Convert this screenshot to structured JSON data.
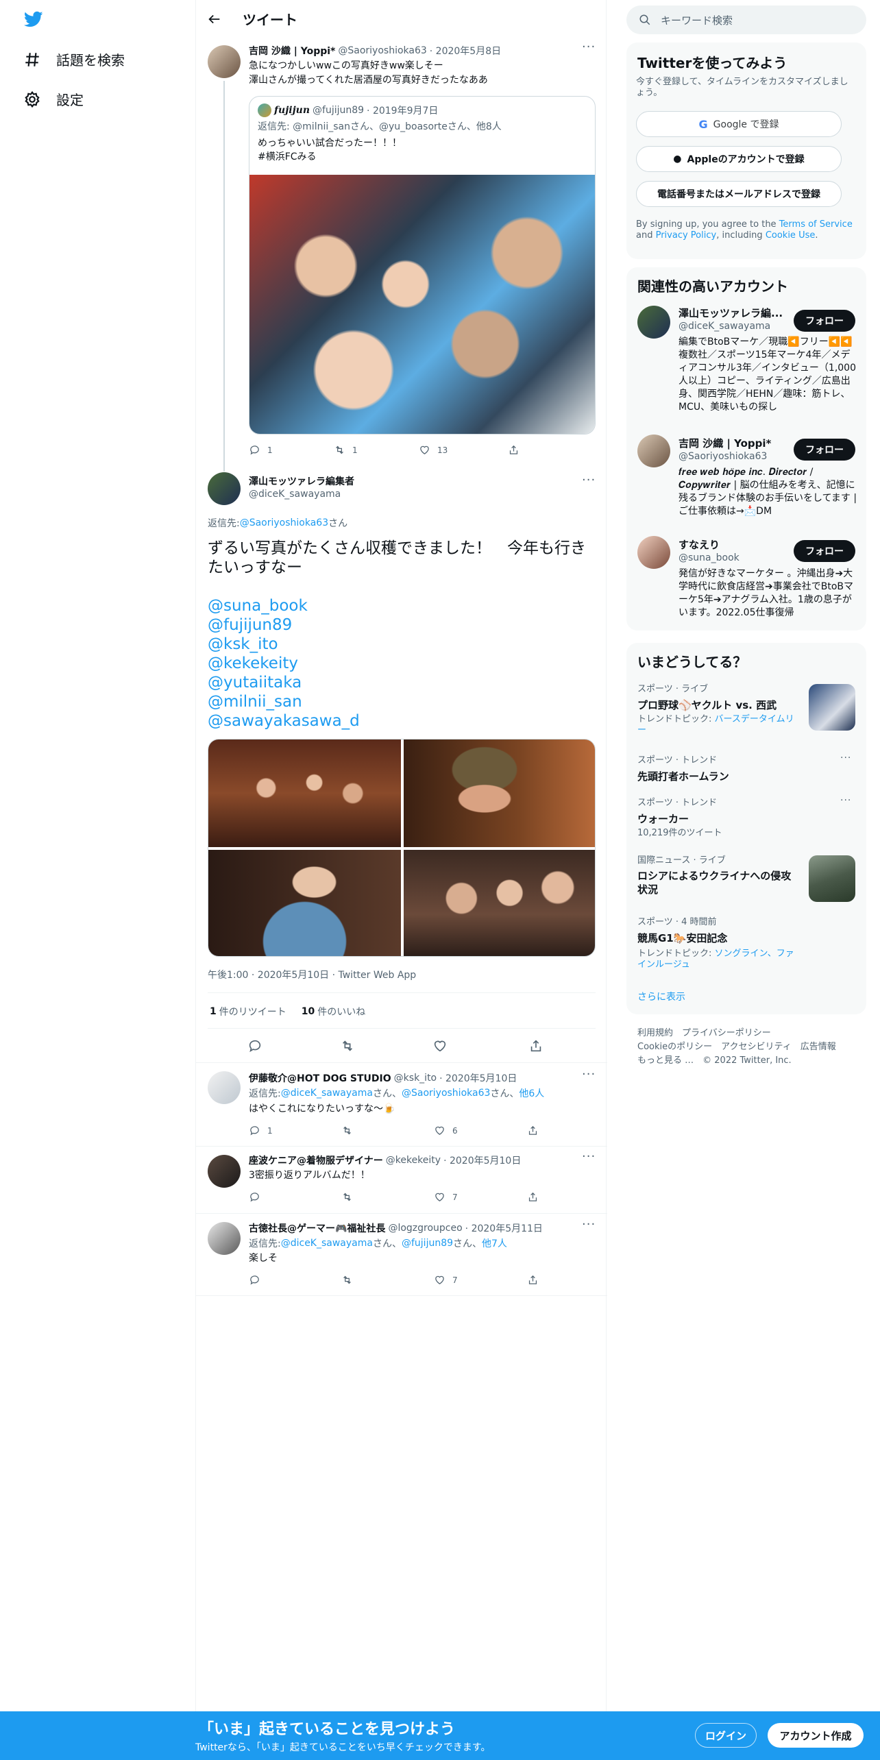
{
  "nav": {
    "explore": "話題を検索",
    "settings": "設定"
  },
  "header": {
    "title": "ツイート"
  },
  "tweet1": {
    "name": "吉岡 沙織 | Yoppi*",
    "handle": "@Saoriyoshioka63",
    "date": "· 2020年5月8日",
    "line1": "急になつかしいwwこの写真好きww楽しそー",
    "line2": "澤山さんが撮ってくれた居酒屋の写真好きだったなああ",
    "quote": {
      "name": "fujijun",
      "handle": "@fujijun89",
      "date": "· 2019年9月7日",
      "reply": "返信先: @milnii_sanさん、@yu_boasorteさん、他8人",
      "line1": "めっちゃいい試合だったー！！！",
      "line2": "#横浜FCみる"
    },
    "replies": "1",
    "retweets": "1",
    "likes": "13"
  },
  "main": {
    "name": "澤山モッツァレラ編集者",
    "handle": "@diceK_sawayama",
    "reply_prefix": "返信先: ",
    "reply_to": "@Saoriyoshioka63",
    "reply_suffix": "さん",
    "text": "ずるい写真がたくさん収穫できました！　今年も行きたいっすなー",
    "mentions": [
      "@suna_book",
      "@fujijun89",
      "@ksk_ito",
      "@kekekeity",
      "@yutaiitaka",
      "@milnii_san",
      "@sawayakasawa_d"
    ],
    "meta": "午後1:00 · 2020年5月10日 · Twitter Web App",
    "retweets_count": "1",
    "retweets_label": "件のリツイート",
    "likes_count": "10",
    "likes_label": "件のいいね"
  },
  "reply1": {
    "name": "伊藤敬介@HOT DOG STUDIO",
    "handle": "@ksk_ito",
    "date": "· 2020年5月10日",
    "reply_prefix": "返信先: ",
    "to1": "@diceK_sawayama",
    "sep1": "さん、",
    "to2": "@Saoriyoshioka63",
    "sep2": "さん、",
    "more": "他6人",
    "text": "はやくこれになりたいっすな〜🍺",
    "replies": "1",
    "likes": "6"
  },
  "reply2": {
    "name": "座波ケニア@着物服デザイナー",
    "handle": "@kekekeity",
    "date": "· 2020年5月10日",
    "text": "3密振り返りアルバムだ！！",
    "likes": "7"
  },
  "reply3": {
    "name": "古徳社長@ゲーマー🎮福祉社長",
    "handle": "@logzgroupceo",
    "date": "· 2020年5月11日",
    "reply_prefix": "返信先: ",
    "to1": "@diceK_sawayama",
    "sep1": "さん、",
    "to2": "@fujijun89",
    "sep2": "さん、",
    "more": "他7人",
    "text": "楽しそ",
    "likes": "7"
  },
  "search": {
    "placeholder": "キーワード検索"
  },
  "signup": {
    "title": "Twitterを使ってみよう",
    "subtitle": "今すぐ登録して、タイムラインをカスタマイズしましょう。",
    "google": "Google で登録",
    "apple": "Appleのアカウントで登録",
    "phone": "電話番号またはメールアドレスで登録",
    "terms_pre": "By signing up, you agree to the ",
    "terms": "Terms of Service",
    "and": " and ",
    "privacy": "Privacy Policy",
    "including": ", including ",
    "cookie": "Cookie Use",
    "end": "."
  },
  "related": {
    "title": "関連性の高いアカウント",
    "follow": "フォロー",
    "accounts": [
      {
        "name": "澤山モッツァレラ編...",
        "handle": "@diceK_sawayama",
        "bio": "編集でBtoBマーケ／現職◀️フリー◀️◀️複数社／スポーツ15年マーケ4年／メディアコンサル3年／インタビュー（1,000人以上）コピー、ライティング／広島出身、関西学院／HEHN／趣味：筋トレ、MCU、美味いもの探し"
      },
      {
        "name": "吉岡 沙織 | Yoppi*",
        "handle": "@Saoriyoshioka63",
        "bio": "𝒇𝒓𝒆𝒆 𝒘𝒆𝒃 𝒉𝒐̈𝒑𝒆 𝒊𝒏𝒄. 𝑫𝒊𝒓𝒆𝒄𝒕𝒐𝒓 / 𝑪𝒐𝒑𝒚𝒘𝒓𝒊𝒕𝒆𝒓 | 脳の仕組みを考え、記憶に残るブランド体験のお手伝いをしてます | ご仕事依頼は→📩DM"
      },
      {
        "name": "すなえり",
        "handle": "@suna_book",
        "bio": "発信が好きなマーケター 。沖縄出身➔大学時代に飲食店経営➔事業会社でBtoBマーケ5年➔アナグラム入社。1歳の息子がいます。2022.05仕事復帰"
      }
    ]
  },
  "trends": {
    "title": "いまどうしてる？",
    "more": "さらに表示",
    "items": [
      {
        "meta": "スポーツ · ライブ",
        "title": "プロ野球⚾ヤクルト vs. 西武",
        "topic_label": "トレンドトピック: ",
        "topic": "バースデータイムリー"
      },
      {
        "meta": "スポーツ · トレンド",
        "title": "先頭打者ホームラン"
      },
      {
        "meta": "スポーツ · トレンド",
        "title": "ウォーカー",
        "count": "10,219件のツイート"
      },
      {
        "meta": "国際ニュース · ライブ",
        "title": "ロシアによるウクライナへの侵攻状況"
      },
      {
        "meta": "スポーツ · 4 時間前",
        "title": "競馬G1🐎安田記念",
        "topic_label": "トレンドトピック: ",
        "topic": "ソングライン、ファインルージュ"
      }
    ]
  },
  "footer": {
    "l1": "利用規約",
    "l2": "プライバシーポリシー",
    "l3": "Cookieのポリシー",
    "l4": "アクセシビリティ",
    "l5": "広告情報",
    "l6": "もっと見る …",
    "copy": "© 2022 Twitter, Inc."
  },
  "bottom": {
    "title": "「いま」起きていることを見つけよう",
    "sub": "Twitterなら、「いま」起きていることをいち早くチェックできます。",
    "login": "ログイン",
    "signup": "アカウント作成"
  },
  "colors": {
    "accent": "#1d9bf0",
    "text": "#0f1419",
    "muted": "#536471"
  }
}
